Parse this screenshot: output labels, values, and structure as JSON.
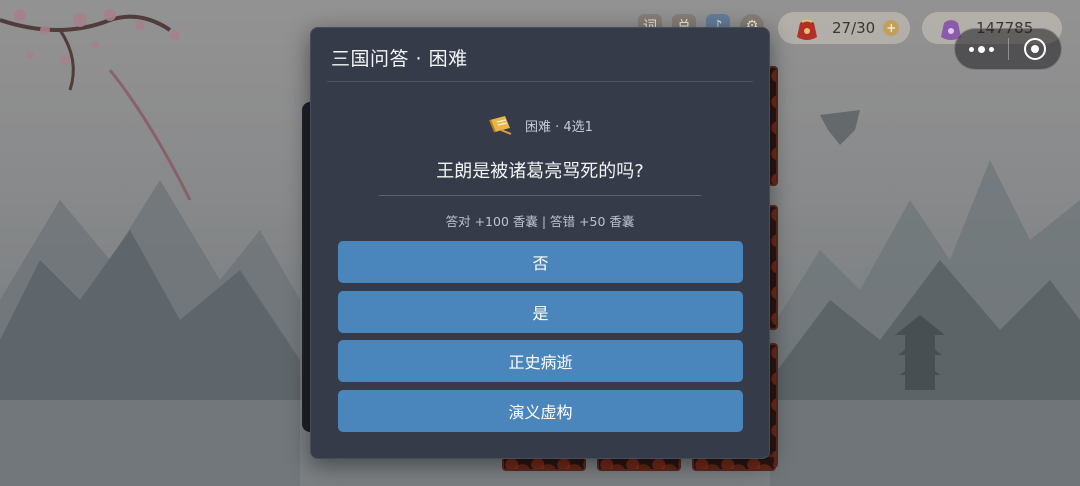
{
  "hud": {
    "icon_1": "词",
    "icon_2": "总",
    "bag_count": "27/30",
    "coin_count": "147785",
    "plus_symbol": "+"
  },
  "dialog": {
    "title": "三国问答 · 困难",
    "difficulty_label": "困难 · 4选1",
    "question": "王朗是被诸葛亮骂死的吗?",
    "reward_text": "答对 +100 香囊 | 答错 +50 香囊",
    "options": [
      "否",
      "是",
      "正史病逝",
      "演义虚构"
    ]
  },
  "colors": {
    "dialog_bg": "#353b49",
    "option_bg": "#4a85bb",
    "text_primary": "#f2f3f5",
    "text_secondary": "#bcc2cc"
  },
  "icons": {
    "difficulty": "scroll-icon",
    "bag": "pouch-icon",
    "more": "more-dots-icon",
    "close": "close-target-icon"
  }
}
